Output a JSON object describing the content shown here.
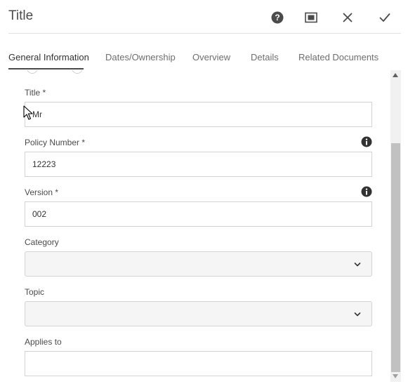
{
  "header": {
    "title": "Title",
    "help_icon": "help-icon",
    "fullscreen_icon": "fullscreen-icon",
    "close_icon": "close-icon",
    "done_icon": "checkmark-icon"
  },
  "tabs": [
    {
      "label": "General Information",
      "active": true
    },
    {
      "label": "Dates/Ownership",
      "active": false
    },
    {
      "label": "Overview",
      "active": false
    },
    {
      "label": "Details",
      "active": false
    },
    {
      "label": "Related Documents",
      "active": false
    }
  ],
  "form": {
    "title": {
      "label": "Title *",
      "value": "Mr"
    },
    "policy_number": {
      "label": "Policy Number *",
      "value": "12223",
      "info_icon": "info-icon"
    },
    "version": {
      "label": "Version *",
      "value": "002",
      "info_icon": "info-icon"
    },
    "category": {
      "label": "Category",
      "value": ""
    },
    "topic": {
      "label": "Topic",
      "value": ""
    },
    "applies_to": {
      "label": "Applies to",
      "value": ""
    }
  },
  "colors": {
    "accent": "#4b4b4b",
    "border": "#d3d3d3",
    "select_bg": "#f5f5f5"
  }
}
